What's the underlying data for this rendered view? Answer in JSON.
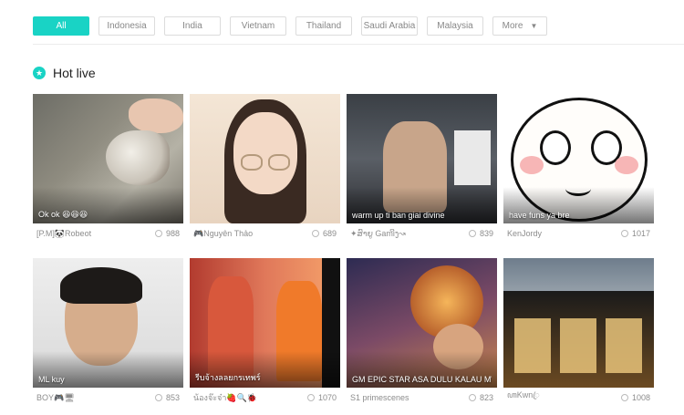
{
  "filters": {
    "items": [
      "All",
      "Indonesia",
      "India",
      "Vietnam",
      "Thailand",
      "Saudi Arabia",
      "Malaysia"
    ],
    "active": "All",
    "more_label": "More"
  },
  "section": {
    "title": "Hot live",
    "icon": "star-icon"
  },
  "colors": {
    "accent": "#19d3c5"
  },
  "cards": [
    {
      "caption": "Ok ok 😆😆😆",
      "streamer": "[P.M]🐼Robeot",
      "viewers": "988"
    },
    {
      "caption": "",
      "streamer": "🎮Nguyên Thảo",
      "viewers": "689"
    },
    {
      "caption": "warm up ti ban giai divine",
      "streamer": "✦ສົາຍູ Gamiິງ↝",
      "viewers": "839"
    },
    {
      "caption": "have funs ya bre",
      "streamer": "KenJordy",
      "viewers": "1017"
    },
    {
      "caption": "ML kuy",
      "streamer": "BOY🎮🖥",
      "viewers": "853"
    },
    {
      "caption": "รีบจ้างลลยกรเทพร์",
      "streamer": "น้องจ๊ะจ๋า🍓🔍🐞",
      "viewers": "1070"
    },
    {
      "caption": "GM EPIC STAR ASA DULU KALAU MW WLIT",
      "streamer": "S1 primescenes",
      "viewers": "823"
    },
    {
      "caption": "",
      "streamer": "ꦲKwnꦿ",
      "viewers": "1008"
    }
  ]
}
